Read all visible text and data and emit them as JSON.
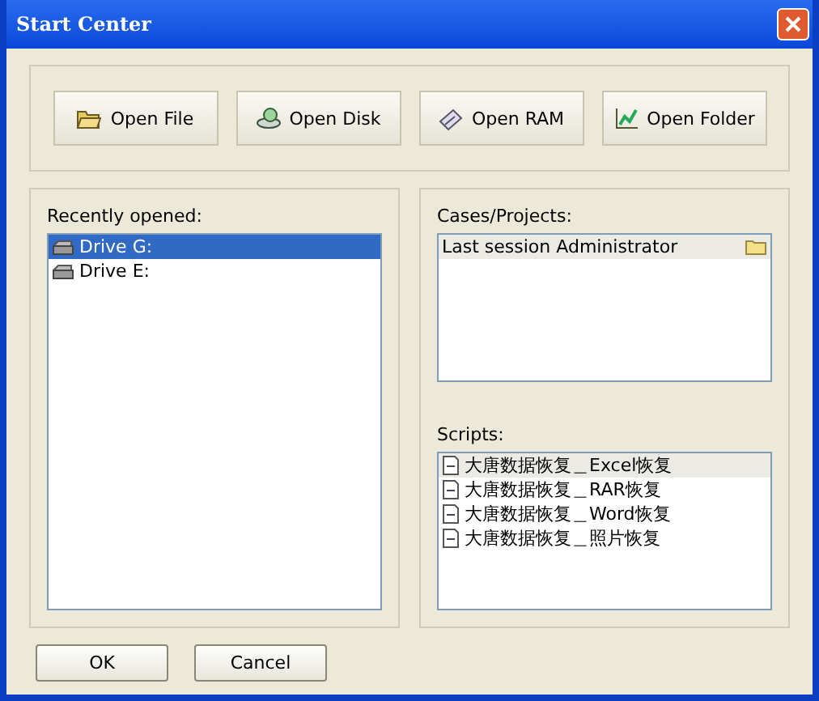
{
  "window": {
    "title": "Start Center"
  },
  "open_buttons": [
    {
      "label": "Open File",
      "kind": "folder"
    },
    {
      "label": "Open Disk",
      "kind": "disk"
    },
    {
      "label": "Open RAM",
      "kind": "ram"
    },
    {
      "label": "Open Folder",
      "kind": "tree"
    }
  ],
  "recently_opened": {
    "label": "Recently opened:",
    "focused": true,
    "items": [
      {
        "label": "Drive G:",
        "selected": true
      },
      {
        "label": "Drive E:",
        "selected": false
      }
    ]
  },
  "cases": {
    "label": "Cases/Projects:",
    "focused": false,
    "items": [
      {
        "label": "Last session Administrator",
        "selected": true
      }
    ]
  },
  "scripts": {
    "label": "Scripts:",
    "focused": false,
    "items": [
      {
        "label": "大唐数据恢复＿Excel恢复",
        "selected": true
      },
      {
        "label": "大唐数据恢复＿RAR恢复",
        "selected": false
      },
      {
        "label": "大唐数据恢复＿Word恢复",
        "selected": false
      },
      {
        "label": "大唐数据恢复＿照片恢复",
        "selected": false
      }
    ]
  },
  "buttons": [
    "OK",
    "Cancel"
  ]
}
